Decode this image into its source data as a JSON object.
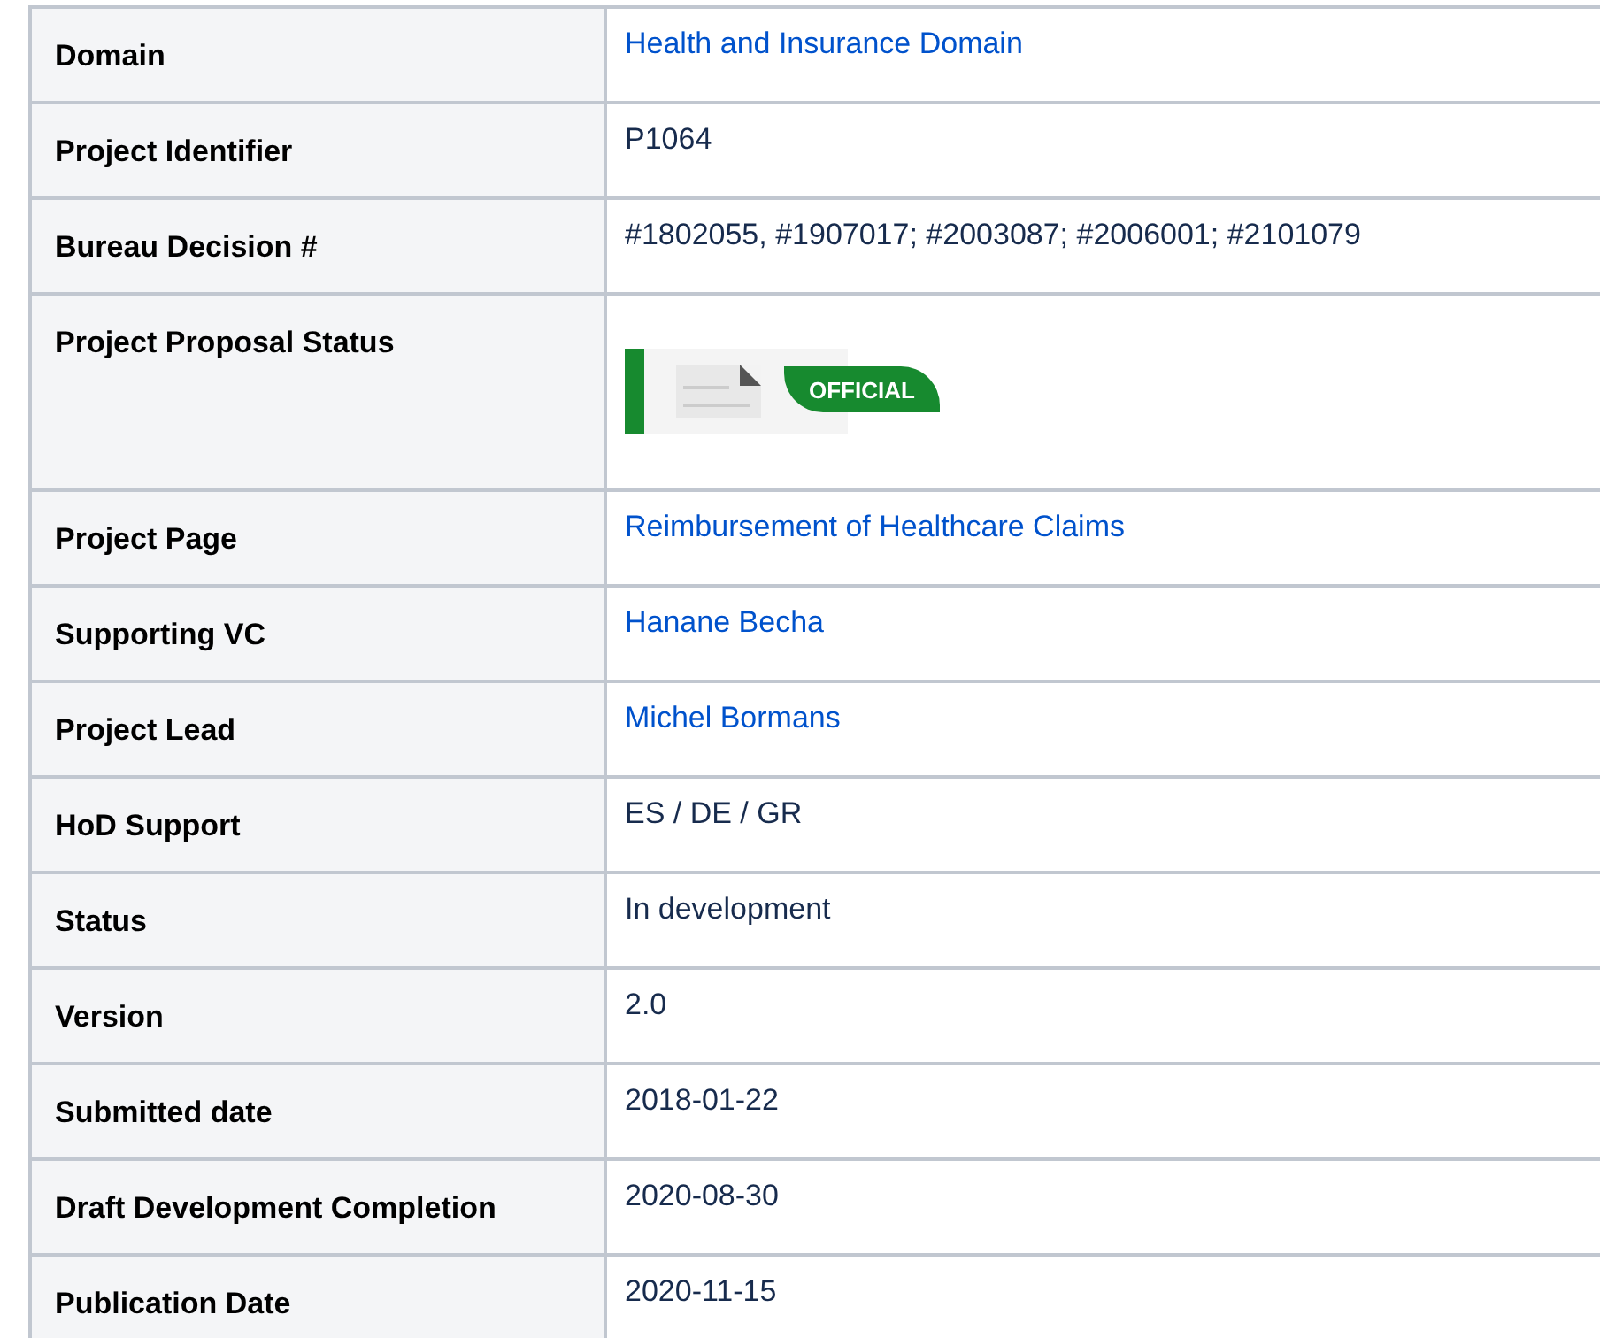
{
  "rows": [
    {
      "label": "Domain",
      "kind": "link",
      "value": "Health and Insurance Domain"
    },
    {
      "label": "Project Identifier",
      "kind": "text",
      "value": "P1064"
    },
    {
      "label": "Bureau Decision #",
      "kind": "text",
      "value": "#1802055, #1907017; #2003087; #2006001; #2101079"
    },
    {
      "label": "Project Proposal Status",
      "kind": "status",
      "value": "OFFICIAL"
    },
    {
      "label": "Project Page",
      "kind": "link",
      "value": "Reimbursement of Healthcare Claims"
    },
    {
      "label": "Supporting VC",
      "kind": "link",
      "value": "Hanane Becha"
    },
    {
      "label": "Project Lead",
      "kind": "link",
      "value": "Michel Bormans"
    },
    {
      "label": "HoD Support",
      "kind": "text",
      "value": "ES / DE / GR"
    },
    {
      "label": "Status",
      "kind": "text",
      "value": "In development"
    },
    {
      "label": "Version",
      "kind": "text",
      "value": "2.0"
    },
    {
      "label": "Submitted date",
      "kind": "text",
      "value": "2018-01-22"
    },
    {
      "label": "Draft Development Completion",
      "kind": "text",
      "value": "2020-08-30"
    },
    {
      "label": "Publication Date",
      "kind": "text",
      "value": "2020-11-15"
    }
  ]
}
